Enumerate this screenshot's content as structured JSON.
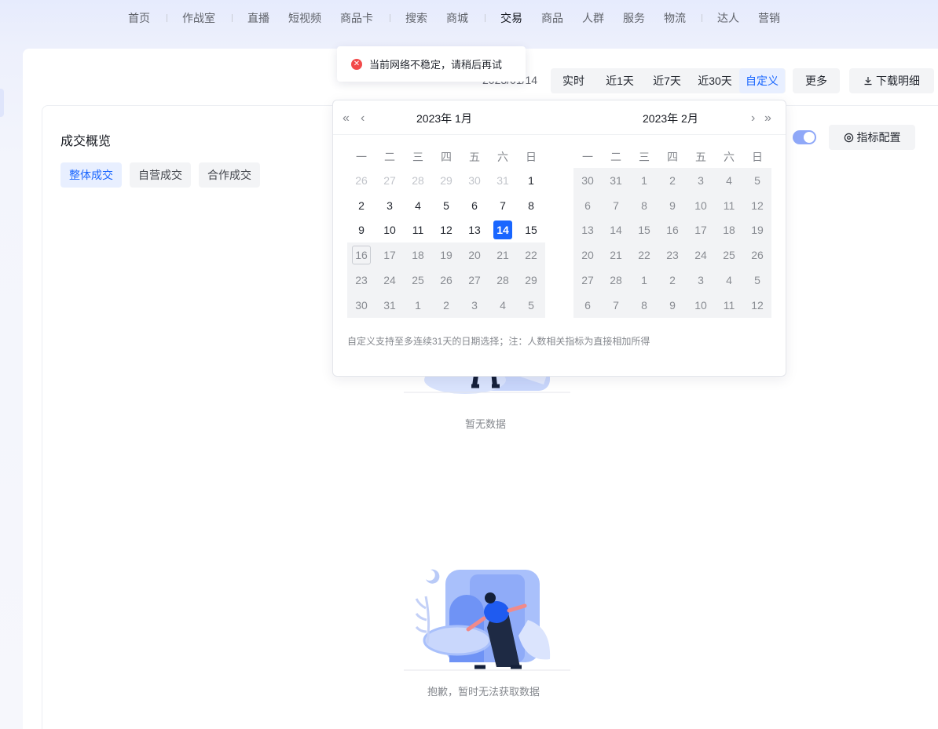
{
  "nav": {
    "items": [
      "首页",
      "作战室",
      "直播",
      "短视频",
      "商品卡",
      "搜索",
      "商城",
      "交易",
      "商品",
      "人群",
      "服务",
      "物流",
      "达人",
      "营销"
    ],
    "active": "交易"
  },
  "toolbar": {
    "date_display": "2023/01/14",
    "ranges": [
      "实时",
      "近1天",
      "近7天",
      "近30天",
      "自定义"
    ],
    "active_range": "自定义",
    "more_label": "更多",
    "download_label": "下载明细"
  },
  "toast": {
    "message": "当前网络不稳定，请稍后再试",
    "icon": "error-circle-icon"
  },
  "section": {
    "title": "成交概览",
    "subtabs": [
      "整体成交",
      "自营成交",
      "合作成交"
    ],
    "active_subtab": "整体成交",
    "toggle_on": true,
    "config_label": "指标配置"
  },
  "calendar": {
    "left_title": "2023年  1月",
    "right_title": "2023年  2月",
    "weekdays": [
      "一",
      "二",
      "三",
      "四",
      "五",
      "六",
      "日"
    ],
    "left_days": [
      [
        "26",
        "27",
        "28",
        "29",
        "30",
        "31",
        "1"
      ],
      [
        "2",
        "3",
        "4",
        "5",
        "6",
        "7",
        "8"
      ],
      [
        "9",
        "10",
        "11",
        "12",
        "13",
        "14",
        "15"
      ],
      [
        "16",
        "17",
        "18",
        "19",
        "20",
        "21",
        "22"
      ],
      [
        "23",
        "24",
        "25",
        "26",
        "27",
        "28",
        "29"
      ],
      [
        "30",
        "31",
        "1",
        "2",
        "3",
        "4",
        "5"
      ]
    ],
    "right_days": [
      [
        "30",
        "31",
        "1",
        "2",
        "3",
        "4",
        "5"
      ],
      [
        "6",
        "7",
        "8",
        "9",
        "10",
        "11",
        "12"
      ],
      [
        "13",
        "14",
        "15",
        "16",
        "17",
        "18",
        "19"
      ],
      [
        "20",
        "21",
        "22",
        "23",
        "24",
        "25",
        "26"
      ],
      [
        "27",
        "28",
        "1",
        "2",
        "3",
        "4",
        "5"
      ],
      [
        "6",
        "7",
        "8",
        "9",
        "10",
        "11",
        "12"
      ]
    ],
    "selected_day": "14",
    "note": "自定义支持至多连续31天的日期选择；注：人数相关指标为直接相加所得"
  },
  "empty_states": {
    "primary": "暂无数据",
    "secondary": "抱歉，暂时无法获取数据"
  },
  "colors": {
    "accent": "#1966ff",
    "error": "#f24a4a"
  }
}
